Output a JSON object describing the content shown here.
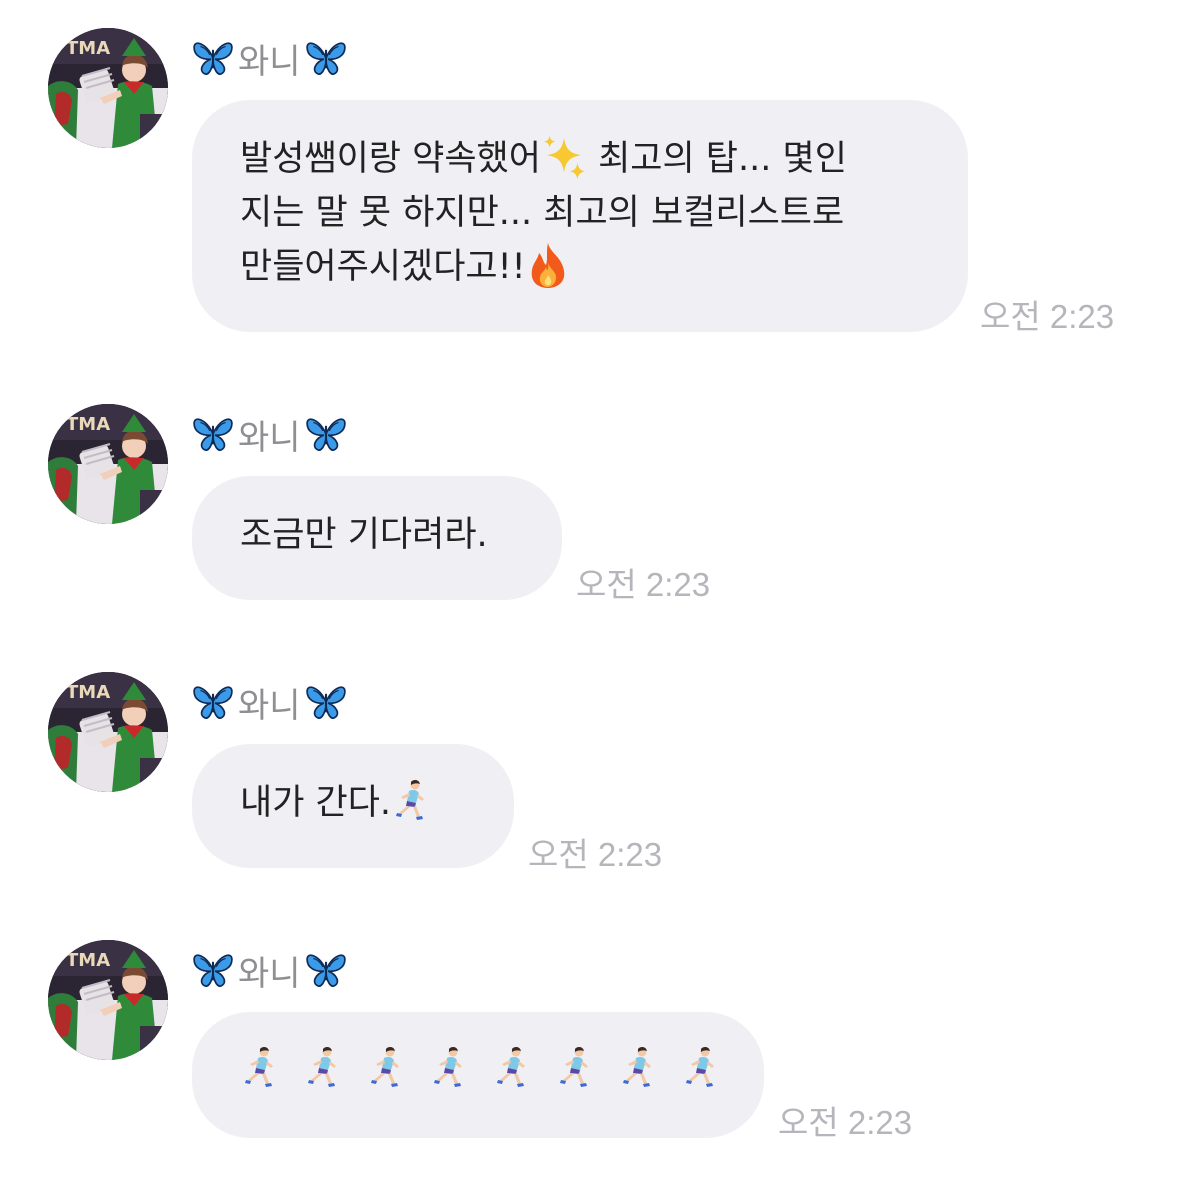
{
  "sender": {
    "name": "와니",
    "avatar_alt": "profile photo"
  },
  "messages": [
    {
      "lines": [
        "발성쌤이랑 약속했어",
        "최고의 탑... 몇인",
        "지는 말 못 하지만... 최고의 보컬리스트로",
        "만들어주시겠다고!!"
      ],
      "time": "오전 2:23"
    },
    {
      "lines": [
        "조금만 기다려라."
      ],
      "time": "오전 2:23"
    },
    {
      "lines": [
        "내가 간다."
      ],
      "time": "오전 2:23"
    },
    {
      "lines": [],
      "time": "오전 2:23"
    }
  ],
  "icons": {
    "sender_prefix": "butterfly-icon",
    "sender_suffix": "butterfly-icon",
    "msg1_a": "sparkles-icon",
    "msg1_b": "fire-icon",
    "msg3": "running-woman-icon",
    "msg4": "running-woman-icon"
  },
  "colors": {
    "bubble": "#f0f0f4",
    "text": "#222222",
    "sender": "#8e8e93",
    "time": "#b5b5bb",
    "butterfly": "#3b9be8"
  }
}
